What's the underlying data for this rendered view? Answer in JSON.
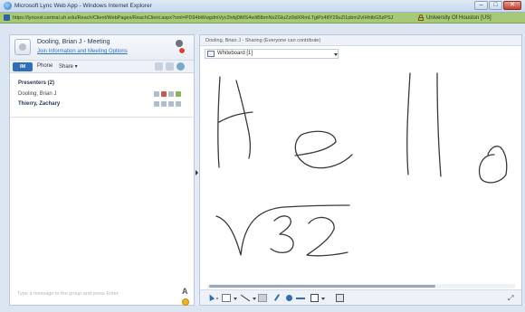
{
  "window": {
    "title": "Microsoft Lync Web App - Windows Internet Explorer",
    "buttons": {
      "minimize": "–",
      "maximize": "□",
      "close": "✕"
    }
  },
  "address_bar": {
    "url": "https://lyncext.central.uh.edu/Reach/Client/WebPages/ReachClient.aspx?xml=PD94bWwgdmVyc2lvbj0iMS4wIiBlbmNvZGluZz0idXRmLTgiPz48Y29uZi1pbmZvIHhtbG5zPSJ",
    "certificate": "University Of Houston [US]"
  },
  "meeting": {
    "title": "Dooling, Brian J - Meeting",
    "join_link": "Join Information and Meeting Options"
  },
  "tabs": {
    "im": "IM",
    "phone": "Phone",
    "share": "Share ▾"
  },
  "participants": {
    "group_label": "Presenters (2)",
    "people": [
      {
        "name": "Dooling, Brian J"
      },
      {
        "name": "Thierry, Zachary"
      }
    ]
  },
  "chat": {
    "placeholder": "Type a message to the group and press Enter",
    "font_button": "A"
  },
  "content": {
    "sharing_text": "Dooling, Brian J - Sharing (Everyone can contribute)",
    "whiteboard_name": "Whiteboard [1]"
  },
  "toolbar": {
    "text_tool": "T",
    "expand": "⤢"
  },
  "colors": {
    "accent": "#2f6fba",
    "address_bar": "#a6c978",
    "ink": "#3a3a3a"
  }
}
